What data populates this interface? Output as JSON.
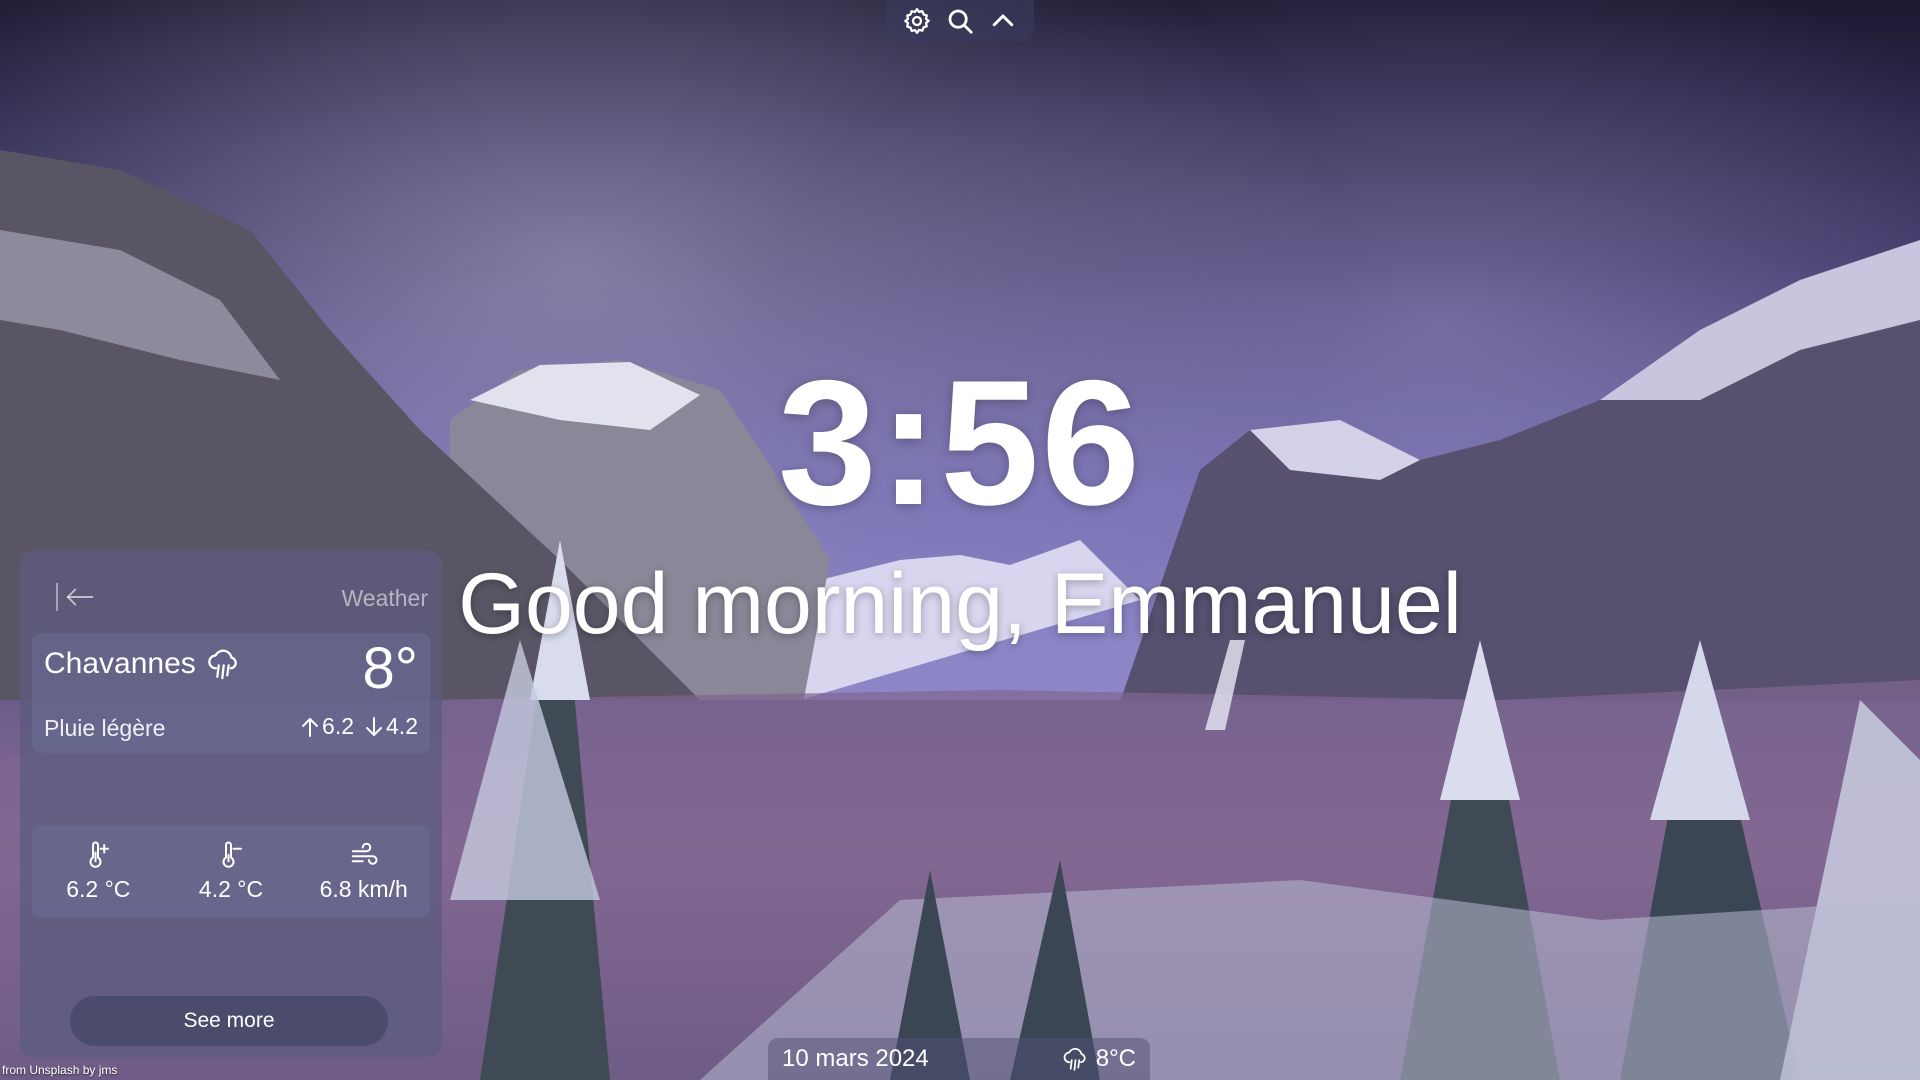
{
  "toolbar": {
    "icons": [
      "gear-icon",
      "search-icon",
      "chevron-up-icon"
    ]
  },
  "clock": {
    "time": "3:56"
  },
  "greeting": {
    "text": "Good morning, Emmanuel"
  },
  "weather": {
    "title": "Weather",
    "city": "Chavannes",
    "temperature": "8°",
    "description": "Pluie légère",
    "max": "6.2",
    "min": "4.2",
    "stats": {
      "max_temp": "6.2 °C",
      "min_temp": "4.2 °C",
      "wind": "6.8 km/h"
    },
    "see_more_label": "See more"
  },
  "bottombar": {
    "date": "10 mars 2024",
    "temp": "8°C"
  },
  "credit": "from Unsplash by jms",
  "colors": {
    "panel": "#5c5c7d",
    "sky_top": "#2a2545",
    "sky_mid": "#6a63a8"
  }
}
